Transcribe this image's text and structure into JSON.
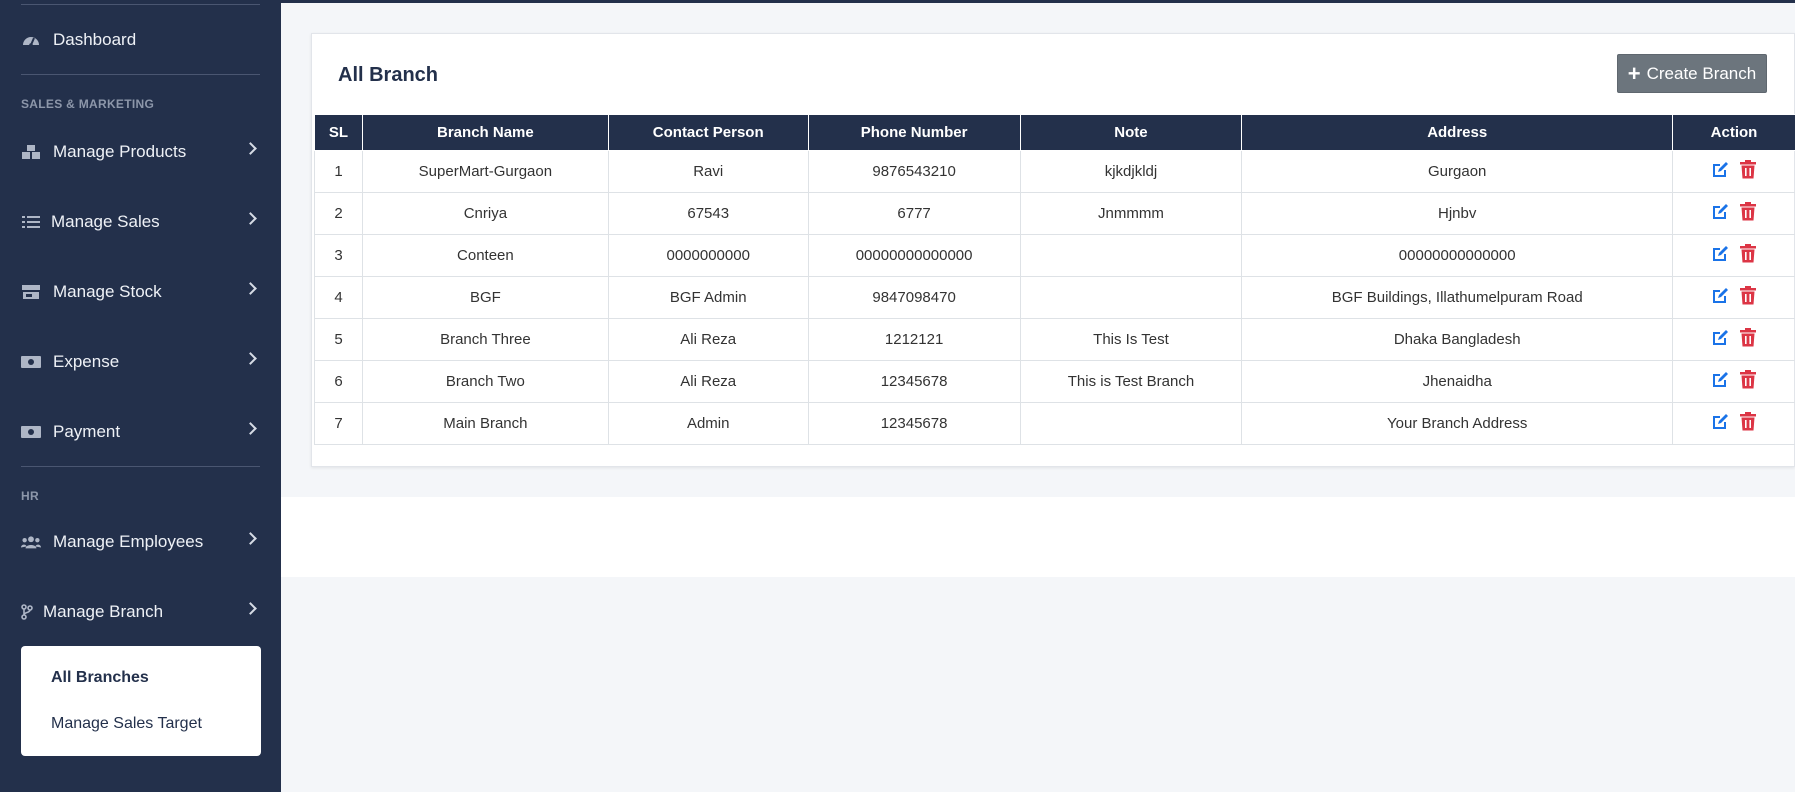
{
  "colors": {
    "sidebar_bg": "#23304b",
    "header_bg": "#23304b",
    "edit_icon": "#1a73e8",
    "delete_icon": "#dc3545",
    "button_bg": "#6c757d"
  },
  "sidebar": {
    "dashboard": "Dashboard",
    "section_sales": "SALES & MARKETING",
    "items_sales": [
      {
        "label": "Manage Products",
        "icon": "boxes-icon"
      },
      {
        "label": "Manage Sales",
        "icon": "list-icon"
      },
      {
        "label": "Manage Stock",
        "icon": "store-icon"
      },
      {
        "label": "Expense",
        "icon": "money-icon"
      },
      {
        "label": "Payment",
        "icon": "money-icon"
      }
    ],
    "section_hr": "HR",
    "items_hr": [
      {
        "label": "Manage Employees",
        "icon": "users-icon"
      },
      {
        "label": "Manage Branch",
        "icon": "branch-icon"
      }
    ],
    "submenu": [
      {
        "label": "All Branches",
        "active": true
      },
      {
        "label": "Manage Sales Target",
        "active": false
      }
    ]
  },
  "card": {
    "title": "All Branch",
    "create_button": "Create Branch"
  },
  "table": {
    "headers": [
      "SL",
      "Branch Name",
      "Contact Person",
      "Phone Number",
      "Note",
      "Address",
      "Action"
    ],
    "rows": [
      [
        "1",
        "SuperMart-Gurgaon",
        "Ravi",
        "9876543210",
        "kjkdjkldj",
        "Gurgaon"
      ],
      [
        "2",
        "Cnriya",
        "67543",
        "6777",
        "Jnmmmm",
        "Hjnbv"
      ],
      [
        "3",
        "Conteen",
        "0000000000",
        "00000000000000",
        "",
        "00000000000000"
      ],
      [
        "4",
        "BGF",
        "BGF Admin",
        "9847098470",
        "",
        "BGF Buildings, Illathumelpuram Road"
      ],
      [
        "5",
        "Branch Three",
        "Ali Reza",
        "1212121",
        "This Is Test",
        "Dhaka Bangladesh"
      ],
      [
        "6",
        "Branch Two",
        "Ali Reza",
        "12345678",
        "This is Test Branch",
        "Jhenaidha"
      ],
      [
        "7",
        "Main Branch",
        "Admin",
        "12345678",
        "",
        "Your Branch Address"
      ]
    ]
  }
}
